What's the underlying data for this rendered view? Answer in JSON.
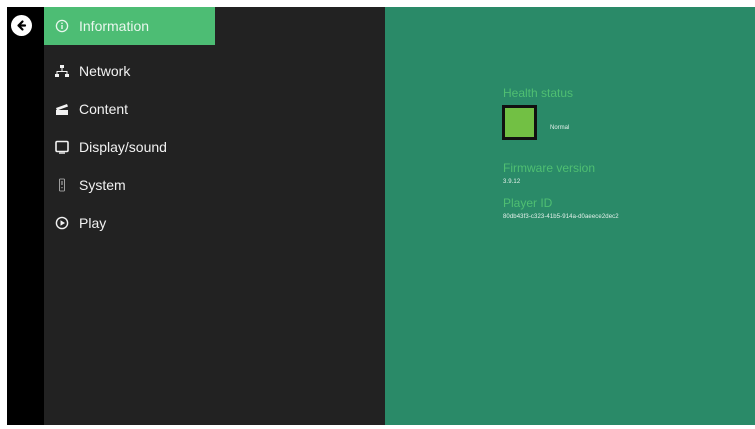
{
  "back": {
    "icon": "back-arrow-icon"
  },
  "menu": {
    "items": [
      {
        "label": "Information",
        "icon": "info-icon",
        "active": true
      },
      {
        "label": "Network",
        "icon": "network-icon"
      },
      {
        "label": "Content",
        "icon": "content-icon"
      },
      {
        "label": "Display/sound",
        "icon": "display-icon"
      },
      {
        "label": "System",
        "icon": "system-icon"
      },
      {
        "label": "Play",
        "icon": "play-icon"
      }
    ]
  },
  "details": {
    "health_label": "Health status",
    "health_value": "Normal",
    "firmware_label": "Firmware version",
    "firmware_value": "3.9.12",
    "player_id_label": "Player ID",
    "player_id_value": "80db43f3-c323-41b5-914a-d0aeece2dec2"
  },
  "colors": {
    "active_item": "#4dbd74",
    "menu_bg": "#222222",
    "panel_bg": "#2a8a68",
    "label_green": "#4fbf72",
    "health_ok": "#72c044"
  }
}
